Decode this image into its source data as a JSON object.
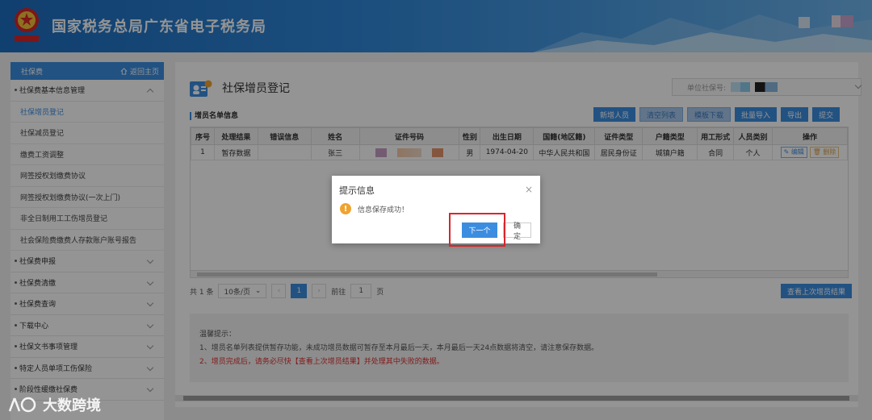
{
  "header": {
    "title": "国家税务总局广东省电子税务局",
    "emblem_text": "中国税务"
  },
  "sidebar": {
    "head_label": "社保费",
    "home_label": "返回主页",
    "group_basic": "社保费基本信息管理",
    "sub_items": [
      "社保增员登记",
      "社保减员登记",
      "缴费工资调整",
      "网签授权划缴费协议",
      "网签授权划缴费协议(一次上门)",
      "非全日制用工工伤增员登记",
      "社会保险费缴费人存款账户账号报告"
    ],
    "groups": [
      "社保费申报",
      "社保费清缴",
      "社保费查询",
      "下载中心",
      "社保文书事项管理",
      "特定人员单项工伤保险",
      "阶段性缓缴社保费"
    ]
  },
  "main": {
    "page_title": "社保增员登记",
    "unit_label": "单位社保号:",
    "section_title": "增员名单信息",
    "toolbar": [
      "新增人员",
      "清空列表",
      "模板下载",
      "批量导入",
      "导出",
      "提交"
    ],
    "columns": [
      "序号",
      "处理结果",
      "错误信息",
      "姓名",
      "证件号码",
      "性别",
      "出生日期",
      "国籍(地区籍)",
      "证件类型",
      "户籍类型",
      "用工形式",
      "人员类别",
      "操作"
    ],
    "rows": [
      {
        "seq": "1",
        "result": "暂存数据",
        "error": "",
        "name": "张三",
        "gender": "男",
        "birth": "1974-04-20",
        "nation": "中华人民共和国",
        "id_type": "居民身份证",
        "hukou": "城镇户籍",
        "employ": "合同",
        "category": "个人",
        "edit": "编辑",
        "delete": "删除"
      }
    ],
    "pager": {
      "total": "共 1 条",
      "page_size": "10条/页",
      "current": "1",
      "goto_label": "前往",
      "goto_value": "1",
      "page_unit": "页"
    },
    "view_last_label": "查看上次增员结果",
    "tips": {
      "title": "温馨提示：",
      "line1": "1、增员名单列表提供暂存功能，未成功增员数据可暂存至本月最后一天，本月最后一天24点数据将清空，请注意保存数据。",
      "line2": "2、增员完成后，请务必尽快【查看上次增员结果】并处理其中失败的数据。"
    }
  },
  "dialog": {
    "title": "提示信息",
    "message": "信息保存成功！",
    "next_label": "下一个",
    "ok_label": "确定"
  },
  "watermark": "大数跨境",
  "colors": {
    "primary": "#3c8de0",
    "highlight": "#d9252a",
    "warning": "#f0a330"
  }
}
